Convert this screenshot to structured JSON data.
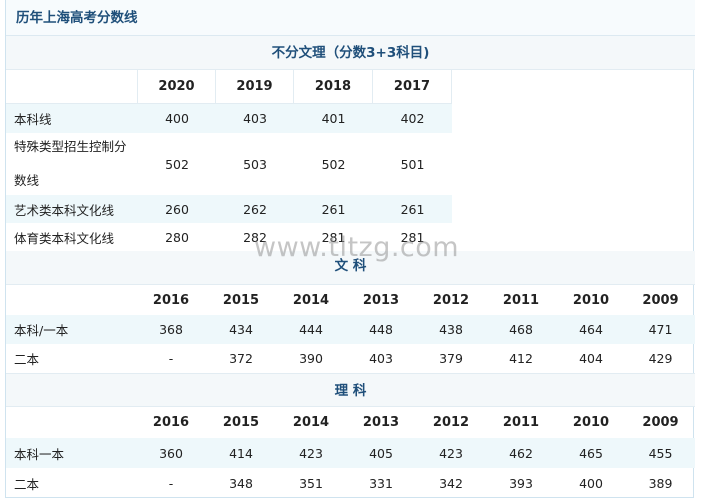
{
  "page_title": "历年上海高考分数线",
  "watermark": "www.tltzg.com",
  "sections": [
    {
      "title": "不分文理（分数3+3科目)",
      "years": [
        "2020",
        "2019",
        "2018",
        "2017"
      ],
      "rows": [
        {
          "label": "本科线",
          "values": [
            "400",
            "403",
            "401",
            "402"
          ]
        },
        {
          "label": "特殊类型招生控制分数线",
          "values": [
            "502",
            "503",
            "502",
            "501"
          ]
        },
        {
          "label": "艺术类本科文化线",
          "values": [
            "260",
            "262",
            "261",
            "261"
          ]
        },
        {
          "label": "体育类本科文化线",
          "values": [
            "280",
            "282",
            "281",
            "281"
          ]
        }
      ]
    },
    {
      "title": "文 科",
      "years": [
        "2016",
        "2015",
        "2014",
        "2013",
        "2012",
        "2011",
        "2010",
        "2009"
      ],
      "rows": [
        {
          "label": "本科/一本",
          "values": [
            "368",
            "434",
            "444",
            "448",
            "438",
            "468",
            "464",
            "471"
          ]
        },
        {
          "label": "二本",
          "values": [
            "-",
            "372",
            "390",
            "403",
            "379",
            "412",
            "404",
            "429"
          ]
        }
      ]
    },
    {
      "title": "理 科",
      "years": [
        "2016",
        "2015",
        "2014",
        "2013",
        "2012",
        "2011",
        "2010",
        "2009"
      ],
      "rows": [
        {
          "label": "本科一本",
          "values": [
            "360",
            "414",
            "423",
            "405",
            "423",
            "462",
            "465",
            "455"
          ]
        },
        {
          "label": "二本",
          "values": [
            "-",
            "348",
            "351",
            "331",
            "342",
            "393",
            "400",
            "389"
          ]
        }
      ]
    }
  ]
}
